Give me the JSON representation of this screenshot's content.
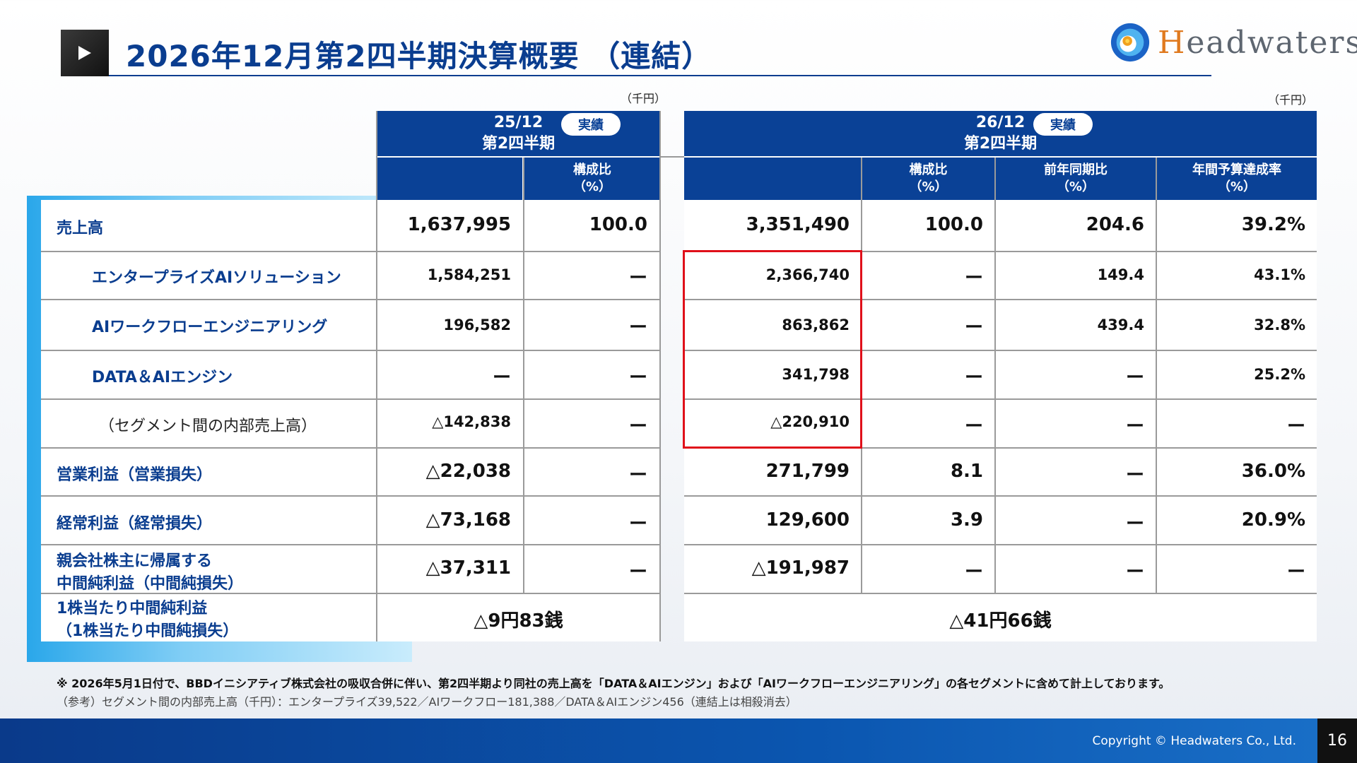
{
  "header": {
    "title": "2026年12月第2四半期決算概要 （連結）",
    "logo_text": "Headwaters"
  },
  "units": {
    "left": "（千円）",
    "right": "（千円）"
  },
  "left_table": {
    "period": "25/12",
    "quarter": "第2四半期",
    "badge": "実績",
    "col_ratio": [
      "構成比",
      "（%）"
    ]
  },
  "right_table": {
    "period": "26/12",
    "quarter": "第2四半期",
    "badge": "実績",
    "col_ratio": [
      "構成比",
      "（%）"
    ],
    "col_yoy": [
      "前年同期比",
      "（%）"
    ],
    "col_budget": [
      "年間予算達成率",
      "（%）"
    ]
  },
  "rows": [
    {
      "label": "売上高",
      "l_val": "1,637,995",
      "l_ratio": "100.0",
      "r_val": "3,351,490",
      "r_ratio": "100.0",
      "r_yoy": "204.6",
      "r_budget": "39.2%"
    },
    {
      "label": "エンタープライズAIソリューション",
      "l_val": "1,584,251",
      "l_ratio": "ー",
      "r_val": "2,366,740",
      "r_ratio": "ー",
      "r_yoy": "149.4",
      "r_budget": "43.1%"
    },
    {
      "label": "AIワークフローエンジニアリング",
      "l_val": "196,582",
      "l_ratio": "ー",
      "r_val": "863,862",
      "r_ratio": "ー",
      "r_yoy": "439.4",
      "r_budget": "32.8%"
    },
    {
      "label": "DATA＆AIエンジン",
      "l_val": "ー",
      "l_ratio": "ー",
      "r_val": "341,798",
      "r_ratio": "ー",
      "r_yoy": "ー",
      "r_budget": "25.2%"
    },
    {
      "label": "（セグメント間の内部売上高）",
      "l_val": "△142,838",
      "l_ratio": "ー",
      "r_val": "△220,910",
      "r_ratio": "ー",
      "r_yoy": "ー",
      "r_budget": "ー"
    },
    {
      "label": "営業利益（営業損失）",
      "l_val": "△22,038",
      "l_ratio": "ー",
      "r_val": "271,799",
      "r_ratio": "8.1",
      "r_yoy": "ー",
      "r_budget": "36.0%"
    },
    {
      "label": "経常利益（経常損失）",
      "l_val": "△73,168",
      "l_ratio": "ー",
      "r_val": "129,600",
      "r_ratio": "3.9",
      "r_yoy": "ー",
      "r_budget": "20.9%"
    },
    {
      "label": [
        "親会社株主に帰属する",
        "中間純利益（中間純損失）"
      ],
      "l_val": "△37,311",
      "l_ratio": "ー",
      "r_val": "△191,987",
      "r_ratio": "ー",
      "r_yoy": "ー",
      "r_budget": "ー"
    },
    {
      "label": [
        "1株当たり中間純利益",
        "（1株当たり中間純損失）"
      ],
      "l_eps": "△9円83銭",
      "r_eps": "△41円66銭"
    }
  ],
  "notes": {
    "note1": "※ 2026年5月1日付で、BBDイニシアティブ株式会社の吸収合併に伴い、第2四半期より同社の売上高を「DATA＆AIエンジン」および「AIワークフローエンジニアリング」の各セグメントに含めて計上しております。",
    "note2": "（参考）セグメント間の内部売上高（千円）：エンタープライズ39,522／AIワークフロー181,388／DATA＆AIエンジン456（連結上は相殺消去）"
  },
  "footer": {
    "copyright": "Copyright © Headwaters Co., Ltd.",
    "page": "16"
  },
  "colors": {
    "navy": "#0a4196",
    "title_blue": "#0a3d8f",
    "highlight_red": "#e0101a"
  }
}
